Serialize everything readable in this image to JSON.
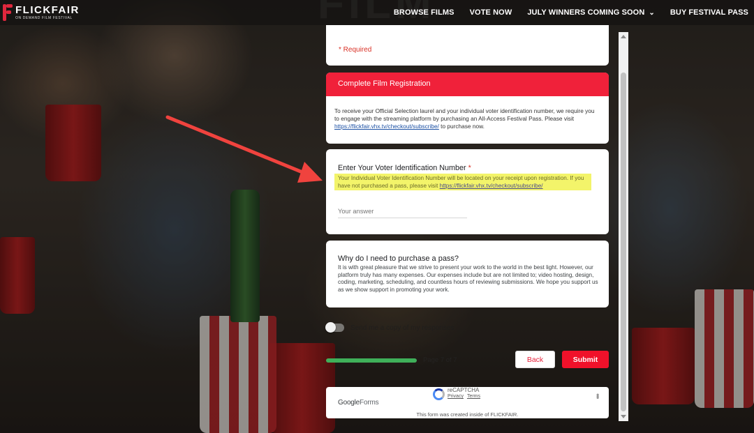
{
  "brand": {
    "name": "FLICKFAIR",
    "tagline": "ON DEMAND FILM FESTIVAL",
    "accent": "#e0273d"
  },
  "nav": {
    "items": [
      {
        "label": "BROWSE FILMS"
      },
      {
        "label": "VOTE NOW"
      },
      {
        "label": "JULY WINNERS COMING SOON",
        "has_dropdown": true
      },
      {
        "label": "BUY FESTIVAL PASS"
      }
    ],
    "background_heading": "FILM"
  },
  "form": {
    "required_note": "* Required",
    "registration": {
      "header": "Complete Film Registration",
      "body_before_link": "To receive your Official Selection laurel and your individual voter identification number, we require you to engage with the streaming platform by purchasing an All-Access Festival Pass. Please visit ",
      "link": "https://flickfair.vhx.tv/checkout/subscribe/",
      "body_after_link": " to purchase now."
    },
    "voter_question": {
      "title": "Enter Your Voter Identification Number",
      "required_mark": "*",
      "note_before_link": "Your Individual Voter Identification Number will be located on your receipt upon registration. If you have not purchased a pass, please visit ",
      "link": "https://flickfair.vhx.tv/checkout/subscribe/",
      "placeholder": "Your answer",
      "value": ""
    },
    "why": {
      "title": "Why do I need to purchase a pass?",
      "body": "It is with great pleasure that we strive to present your work to the world in the best light. However, our platform truly has many expenses. Our expenses include but are not limited to; video hosting, design, coding, marketing, scheduling, and countless hours of reviewing submissions. We hope you support us as we show support in promoting your work."
    },
    "send_copy_label": "Send me a copy of my responses",
    "send_copy_enabled": false,
    "progress": {
      "label": "Page 7 of 7",
      "fraction": 1.0,
      "color": "#3fb05a"
    },
    "back_label": "Back",
    "submit_label": "Submit",
    "submit_color": "#f0112a"
  },
  "footer": {
    "google_forms": "Google",
    "google_forms_suffix": "Forms",
    "recaptcha": "reCAPTCHA",
    "privacy": "Privacy",
    "terms": "Terms",
    "created_note": "This form was created inside of FLICKFAIR."
  }
}
